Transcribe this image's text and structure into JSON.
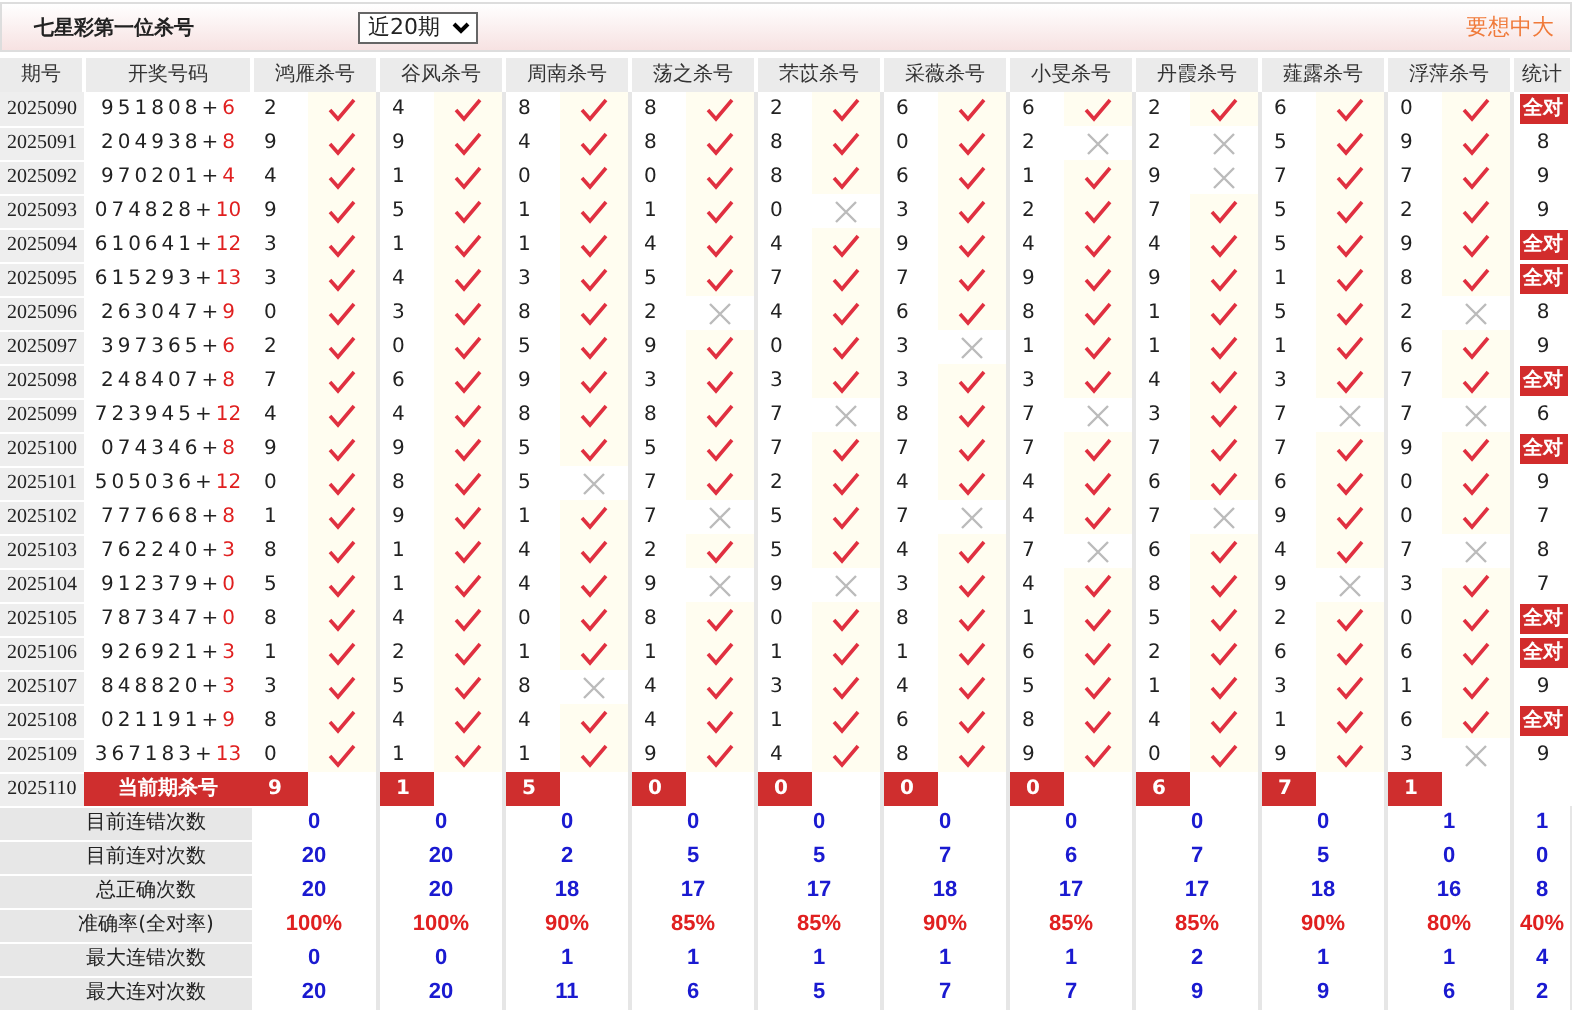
{
  "title": "七星彩第一位杀号",
  "range_select": {
    "value": "近20期"
  },
  "promo": "要想中大",
  "columns": [
    "期号",
    "开奖号码",
    "鸿雁杀号",
    "谷风杀号",
    "周南杀号",
    "荡之杀号",
    "芣苡杀号",
    "采薇杀号",
    "小旻杀号",
    "丹霞杀号",
    "薤露杀号",
    "浮萍杀号",
    "统计"
  ],
  "rows": [
    {
      "period": "2025090",
      "draw": "951808+",
      "special": "6",
      "kills": [
        {
          "n": "2",
          "ok": true
        },
        {
          "n": "4",
          "ok": true
        },
        {
          "n": "8",
          "ok": true
        },
        {
          "n": "8",
          "ok": true
        },
        {
          "n": "2",
          "ok": true
        },
        {
          "n": "6",
          "ok": true
        },
        {
          "n": "6",
          "ok": true
        },
        {
          "n": "2",
          "ok": true
        },
        {
          "n": "6",
          "ok": true
        },
        {
          "n": "0",
          "ok": true
        }
      ],
      "stat": {
        "text": "全对",
        "all_correct": true
      }
    },
    {
      "period": "2025091",
      "draw": "204938+",
      "special": "8",
      "kills": [
        {
          "n": "9",
          "ok": true
        },
        {
          "n": "9",
          "ok": true
        },
        {
          "n": "4",
          "ok": true
        },
        {
          "n": "8",
          "ok": true
        },
        {
          "n": "8",
          "ok": true
        },
        {
          "n": "0",
          "ok": true
        },
        {
          "n": "2",
          "ok": false
        },
        {
          "n": "2",
          "ok": false
        },
        {
          "n": "5",
          "ok": true
        },
        {
          "n": "9",
          "ok": true
        }
      ],
      "stat": {
        "text": "8",
        "all_correct": false
      }
    },
    {
      "period": "2025092",
      "draw": "970201+",
      "special": "4",
      "kills": [
        {
          "n": "4",
          "ok": true
        },
        {
          "n": "1",
          "ok": true
        },
        {
          "n": "0",
          "ok": true
        },
        {
          "n": "0",
          "ok": true
        },
        {
          "n": "8",
          "ok": true
        },
        {
          "n": "6",
          "ok": true
        },
        {
          "n": "1",
          "ok": true
        },
        {
          "n": "9",
          "ok": false
        },
        {
          "n": "7",
          "ok": true
        },
        {
          "n": "7",
          "ok": true
        }
      ],
      "stat": {
        "text": "9",
        "all_correct": false
      }
    },
    {
      "period": "2025093",
      "draw": "074828+",
      "special": "10",
      "kills": [
        {
          "n": "9",
          "ok": true
        },
        {
          "n": "5",
          "ok": true
        },
        {
          "n": "1",
          "ok": true
        },
        {
          "n": "1",
          "ok": true
        },
        {
          "n": "0",
          "ok": false
        },
        {
          "n": "3",
          "ok": true
        },
        {
          "n": "2",
          "ok": true
        },
        {
          "n": "7",
          "ok": true
        },
        {
          "n": "5",
          "ok": true
        },
        {
          "n": "2",
          "ok": true
        }
      ],
      "stat": {
        "text": "9",
        "all_correct": false
      }
    },
    {
      "period": "2025094",
      "draw": "610641+",
      "special": "12",
      "kills": [
        {
          "n": "3",
          "ok": true
        },
        {
          "n": "1",
          "ok": true
        },
        {
          "n": "1",
          "ok": true
        },
        {
          "n": "4",
          "ok": true
        },
        {
          "n": "4",
          "ok": true
        },
        {
          "n": "9",
          "ok": true
        },
        {
          "n": "4",
          "ok": true
        },
        {
          "n": "4",
          "ok": true
        },
        {
          "n": "5",
          "ok": true
        },
        {
          "n": "9",
          "ok": true
        }
      ],
      "stat": {
        "text": "全对",
        "all_correct": true
      }
    },
    {
      "period": "2025095",
      "draw": "615293+",
      "special": "13",
      "kills": [
        {
          "n": "3",
          "ok": true
        },
        {
          "n": "4",
          "ok": true
        },
        {
          "n": "3",
          "ok": true
        },
        {
          "n": "5",
          "ok": true
        },
        {
          "n": "7",
          "ok": true
        },
        {
          "n": "7",
          "ok": true
        },
        {
          "n": "9",
          "ok": true
        },
        {
          "n": "9",
          "ok": true
        },
        {
          "n": "1",
          "ok": true
        },
        {
          "n": "8",
          "ok": true
        }
      ],
      "stat": {
        "text": "全对",
        "all_correct": true
      }
    },
    {
      "period": "2025096",
      "draw": "263047+",
      "special": "9",
      "kills": [
        {
          "n": "0",
          "ok": true
        },
        {
          "n": "3",
          "ok": true
        },
        {
          "n": "8",
          "ok": true
        },
        {
          "n": "2",
          "ok": false
        },
        {
          "n": "4",
          "ok": true
        },
        {
          "n": "6",
          "ok": true
        },
        {
          "n": "8",
          "ok": true
        },
        {
          "n": "1",
          "ok": true
        },
        {
          "n": "5",
          "ok": true
        },
        {
          "n": "2",
          "ok": false
        }
      ],
      "stat": {
        "text": "8",
        "all_correct": false
      }
    },
    {
      "period": "2025097",
      "draw": "397365+",
      "special": "6",
      "kills": [
        {
          "n": "2",
          "ok": true
        },
        {
          "n": "0",
          "ok": true
        },
        {
          "n": "5",
          "ok": true
        },
        {
          "n": "9",
          "ok": true
        },
        {
          "n": "0",
          "ok": true
        },
        {
          "n": "3",
          "ok": false
        },
        {
          "n": "1",
          "ok": true
        },
        {
          "n": "1",
          "ok": true
        },
        {
          "n": "1",
          "ok": true
        },
        {
          "n": "6",
          "ok": true
        }
      ],
      "stat": {
        "text": "9",
        "all_correct": false
      }
    },
    {
      "period": "2025098",
      "draw": "248407+",
      "special": "8",
      "kills": [
        {
          "n": "7",
          "ok": true
        },
        {
          "n": "6",
          "ok": true
        },
        {
          "n": "9",
          "ok": true
        },
        {
          "n": "3",
          "ok": true
        },
        {
          "n": "3",
          "ok": true
        },
        {
          "n": "3",
          "ok": true
        },
        {
          "n": "3",
          "ok": true
        },
        {
          "n": "4",
          "ok": true
        },
        {
          "n": "3",
          "ok": true
        },
        {
          "n": "7",
          "ok": true
        }
      ],
      "stat": {
        "text": "全对",
        "all_correct": true
      }
    },
    {
      "period": "2025099",
      "draw": "723945+",
      "special": "12",
      "kills": [
        {
          "n": "4",
          "ok": true
        },
        {
          "n": "4",
          "ok": true
        },
        {
          "n": "8",
          "ok": true
        },
        {
          "n": "8",
          "ok": true
        },
        {
          "n": "7",
          "ok": false
        },
        {
          "n": "8",
          "ok": true
        },
        {
          "n": "7",
          "ok": false
        },
        {
          "n": "3",
          "ok": true
        },
        {
          "n": "7",
          "ok": false
        },
        {
          "n": "7",
          "ok": false
        }
      ],
      "stat": {
        "text": "6",
        "all_correct": false
      }
    },
    {
      "period": "2025100",
      "draw": "074346+",
      "special": "8",
      "kills": [
        {
          "n": "9",
          "ok": true
        },
        {
          "n": "9",
          "ok": true
        },
        {
          "n": "5",
          "ok": true
        },
        {
          "n": "5",
          "ok": true
        },
        {
          "n": "7",
          "ok": true
        },
        {
          "n": "7",
          "ok": true
        },
        {
          "n": "7",
          "ok": true
        },
        {
          "n": "7",
          "ok": true
        },
        {
          "n": "7",
          "ok": true
        },
        {
          "n": "9",
          "ok": true
        }
      ],
      "stat": {
        "text": "全对",
        "all_correct": true
      }
    },
    {
      "period": "2025101",
      "draw": "505036+",
      "special": "12",
      "kills": [
        {
          "n": "0",
          "ok": true
        },
        {
          "n": "8",
          "ok": true
        },
        {
          "n": "5",
          "ok": false
        },
        {
          "n": "7",
          "ok": true
        },
        {
          "n": "2",
          "ok": true
        },
        {
          "n": "4",
          "ok": true
        },
        {
          "n": "4",
          "ok": true
        },
        {
          "n": "6",
          "ok": true
        },
        {
          "n": "6",
          "ok": true
        },
        {
          "n": "0",
          "ok": true
        }
      ],
      "stat": {
        "text": "9",
        "all_correct": false
      }
    },
    {
      "period": "2025102",
      "draw": "777668+",
      "special": "8",
      "kills": [
        {
          "n": "1",
          "ok": true
        },
        {
          "n": "9",
          "ok": true
        },
        {
          "n": "1",
          "ok": true
        },
        {
          "n": "7",
          "ok": false
        },
        {
          "n": "5",
          "ok": true
        },
        {
          "n": "7",
          "ok": false
        },
        {
          "n": "4",
          "ok": true
        },
        {
          "n": "7",
          "ok": false
        },
        {
          "n": "9",
          "ok": true
        },
        {
          "n": "0",
          "ok": true
        }
      ],
      "stat": {
        "text": "7",
        "all_correct": false
      }
    },
    {
      "period": "2025103",
      "draw": "762240+",
      "special": "3",
      "kills": [
        {
          "n": "8",
          "ok": true
        },
        {
          "n": "1",
          "ok": true
        },
        {
          "n": "4",
          "ok": true
        },
        {
          "n": "2",
          "ok": true
        },
        {
          "n": "5",
          "ok": true
        },
        {
          "n": "4",
          "ok": true
        },
        {
          "n": "7",
          "ok": false
        },
        {
          "n": "6",
          "ok": true
        },
        {
          "n": "4",
          "ok": true
        },
        {
          "n": "7",
          "ok": false
        }
      ],
      "stat": {
        "text": "8",
        "all_correct": false
      }
    },
    {
      "period": "2025104",
      "draw": "912379+",
      "special": "0",
      "kills": [
        {
          "n": "5",
          "ok": true
        },
        {
          "n": "1",
          "ok": true
        },
        {
          "n": "4",
          "ok": true
        },
        {
          "n": "9",
          "ok": false
        },
        {
          "n": "9",
          "ok": false
        },
        {
          "n": "3",
          "ok": true
        },
        {
          "n": "4",
          "ok": true
        },
        {
          "n": "8",
          "ok": true
        },
        {
          "n": "9",
          "ok": false
        },
        {
          "n": "3",
          "ok": true
        }
      ],
      "stat": {
        "text": "7",
        "all_correct": false
      }
    },
    {
      "period": "2025105",
      "draw": "787347+",
      "special": "0",
      "kills": [
        {
          "n": "8",
          "ok": true
        },
        {
          "n": "4",
          "ok": true
        },
        {
          "n": "0",
          "ok": true
        },
        {
          "n": "8",
          "ok": true
        },
        {
          "n": "0",
          "ok": true
        },
        {
          "n": "8",
          "ok": true
        },
        {
          "n": "1",
          "ok": true
        },
        {
          "n": "5",
          "ok": true
        },
        {
          "n": "2",
          "ok": true
        },
        {
          "n": "0",
          "ok": true
        }
      ],
      "stat": {
        "text": "全对",
        "all_correct": true
      }
    },
    {
      "period": "2025106",
      "draw": "926921+",
      "special": "3",
      "kills": [
        {
          "n": "1",
          "ok": true
        },
        {
          "n": "2",
          "ok": true
        },
        {
          "n": "1",
          "ok": true
        },
        {
          "n": "1",
          "ok": true
        },
        {
          "n": "1",
          "ok": true
        },
        {
          "n": "1",
          "ok": true
        },
        {
          "n": "6",
          "ok": true
        },
        {
          "n": "2",
          "ok": true
        },
        {
          "n": "6",
          "ok": true
        },
        {
          "n": "6",
          "ok": true
        }
      ],
      "stat": {
        "text": "全对",
        "all_correct": true
      }
    },
    {
      "period": "2025107",
      "draw": "848820+",
      "special": "3",
      "kills": [
        {
          "n": "3",
          "ok": true
        },
        {
          "n": "5",
          "ok": true
        },
        {
          "n": "8",
          "ok": false
        },
        {
          "n": "4",
          "ok": true
        },
        {
          "n": "3",
          "ok": true
        },
        {
          "n": "4",
          "ok": true
        },
        {
          "n": "5",
          "ok": true
        },
        {
          "n": "1",
          "ok": true
        },
        {
          "n": "3",
          "ok": true
        },
        {
          "n": "1",
          "ok": true
        }
      ],
      "stat": {
        "text": "9",
        "all_correct": false
      }
    },
    {
      "period": "2025108",
      "draw": "021191+",
      "special": "9",
      "kills": [
        {
          "n": "8",
          "ok": true
        },
        {
          "n": "4",
          "ok": true
        },
        {
          "n": "4",
          "ok": true
        },
        {
          "n": "4",
          "ok": true
        },
        {
          "n": "1",
          "ok": true
        },
        {
          "n": "6",
          "ok": true
        },
        {
          "n": "8",
          "ok": true
        },
        {
          "n": "4",
          "ok": true
        },
        {
          "n": "1",
          "ok": true
        },
        {
          "n": "6",
          "ok": true
        }
      ],
      "stat": {
        "text": "全对",
        "all_correct": true
      }
    },
    {
      "period": "2025109",
      "draw": "367183+",
      "special": "13",
      "kills": [
        {
          "n": "0",
          "ok": true
        },
        {
          "n": "1",
          "ok": true
        },
        {
          "n": "1",
          "ok": true
        },
        {
          "n": "9",
          "ok": true
        },
        {
          "n": "4",
          "ok": true
        },
        {
          "n": "8",
          "ok": true
        },
        {
          "n": "9",
          "ok": true
        },
        {
          "n": "0",
          "ok": true
        },
        {
          "n": "9",
          "ok": true
        },
        {
          "n": "3",
          "ok": false
        }
      ],
      "stat": {
        "text": "9",
        "all_correct": false
      }
    }
  ],
  "current": {
    "period": "2025110",
    "label": "当前期杀号",
    "kills": [
      "9",
      "1",
      "5",
      "0",
      "0",
      "0",
      "0",
      "6",
      "7",
      "1"
    ]
  },
  "summary": [
    {
      "label": "目前连错次数",
      "kind": "count",
      "values": [
        "0",
        "0",
        "0",
        "0",
        "0",
        "0",
        "0",
        "0",
        "0",
        "1",
        "1"
      ]
    },
    {
      "label": "目前连对次数",
      "kind": "count",
      "values": [
        "20",
        "20",
        "2",
        "5",
        "5",
        "7",
        "6",
        "7",
        "5",
        "0",
        "0"
      ]
    },
    {
      "label": "总正确次数",
      "kind": "count",
      "values": [
        "20",
        "20",
        "18",
        "17",
        "17",
        "18",
        "17",
        "17",
        "18",
        "16",
        "8"
      ]
    },
    {
      "label": "准确率(全对率)",
      "kind": "rate",
      "values": [
        "100%",
        "100%",
        "90%",
        "85%",
        "85%",
        "90%",
        "85%",
        "85%",
        "90%",
        "80%",
        "40%"
      ]
    },
    {
      "label": "最大连错次数",
      "kind": "count",
      "values": [
        "0",
        "0",
        "1",
        "1",
        "1",
        "1",
        "1",
        "2",
        "1",
        "1",
        "4"
      ]
    },
    {
      "label": "最大连对次数",
      "kind": "count",
      "values": [
        "20",
        "20",
        "11",
        "6",
        "5",
        "7",
        "7",
        "9",
        "9",
        "6",
        "2"
      ]
    }
  ]
}
